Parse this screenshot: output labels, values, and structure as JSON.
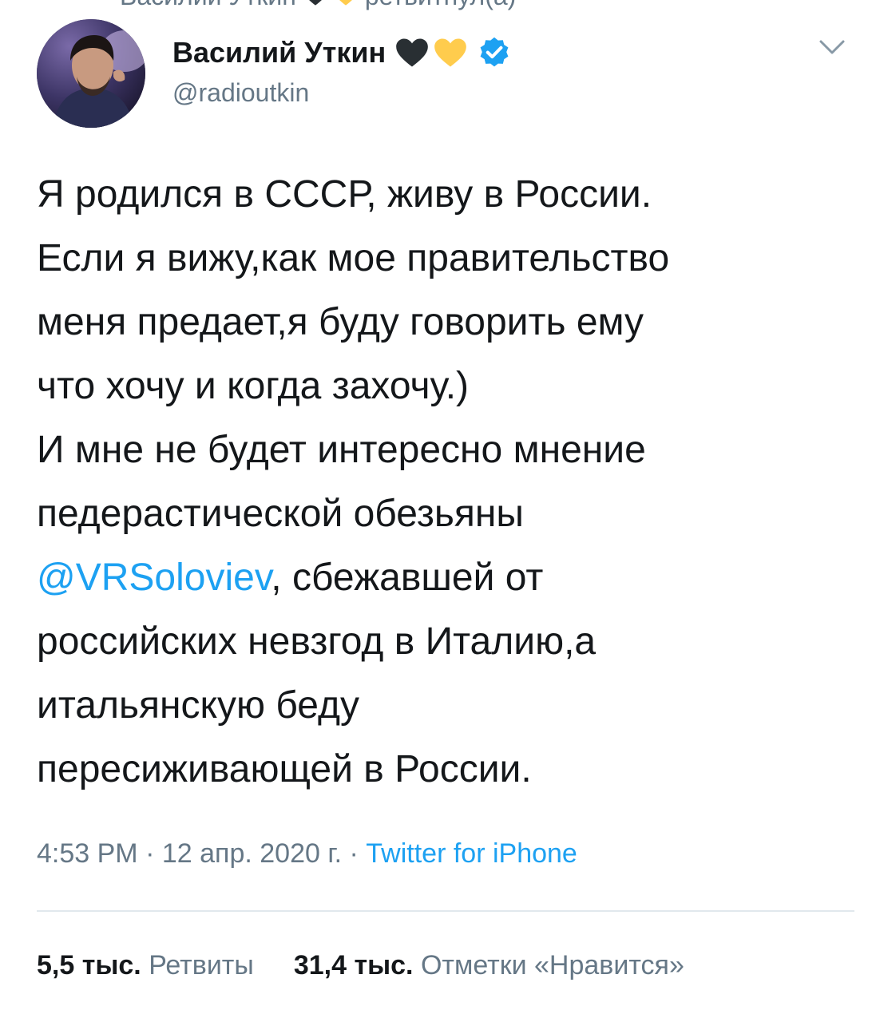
{
  "retweet_context": {
    "name": "Василий Уткин",
    "action": "ретвитнул(а)"
  },
  "tweet": {
    "author": {
      "display_name": "Василий Уткин",
      "handle": "@radioutkin",
      "verified": true
    },
    "text_lines": [
      {
        "text": "Я родился в СССР, живу в России."
      },
      {
        "text": "Если я вижу,как мое правительство"
      },
      {
        "text": "меня предает,я буду говорить ему"
      },
      {
        "text": "что хочу и когда захочу.)"
      },
      {
        "text": "И мне не будет интересно мнение"
      },
      {
        "text": "педерастической обезьяны"
      },
      {
        "mention": "@VRSoloviev",
        "text": ", сбежавшей от"
      },
      {
        "text": "российских невзгод в Италию,а"
      },
      {
        "text": "итальянскую беду"
      },
      {
        "text": "пересиживающей в России."
      }
    ],
    "time": "4:53 PM",
    "separator": "·",
    "date": "12 апр. 2020 г.",
    "source": "Twitter for iPhone",
    "retweets": {
      "count": "5,5 тыс.",
      "label": "Ретвиты"
    },
    "likes": {
      "count": "31,4 тыс.",
      "label": "Отметки «Нравится»"
    }
  },
  "icons": {
    "heart_black": "black-heart-icon",
    "heart_yellow": "yellow-heart-icon",
    "verified": "verified-badge-icon",
    "more": "chevron-down-icon"
  },
  "colors": {
    "link": "#1da1f2",
    "secondary_text": "#657786",
    "primary_text": "#14171a",
    "divider": "#e1e8ed",
    "heart_black": "#292f33",
    "heart_yellow": "#ffcc4d",
    "verified": "#1da1f2"
  }
}
